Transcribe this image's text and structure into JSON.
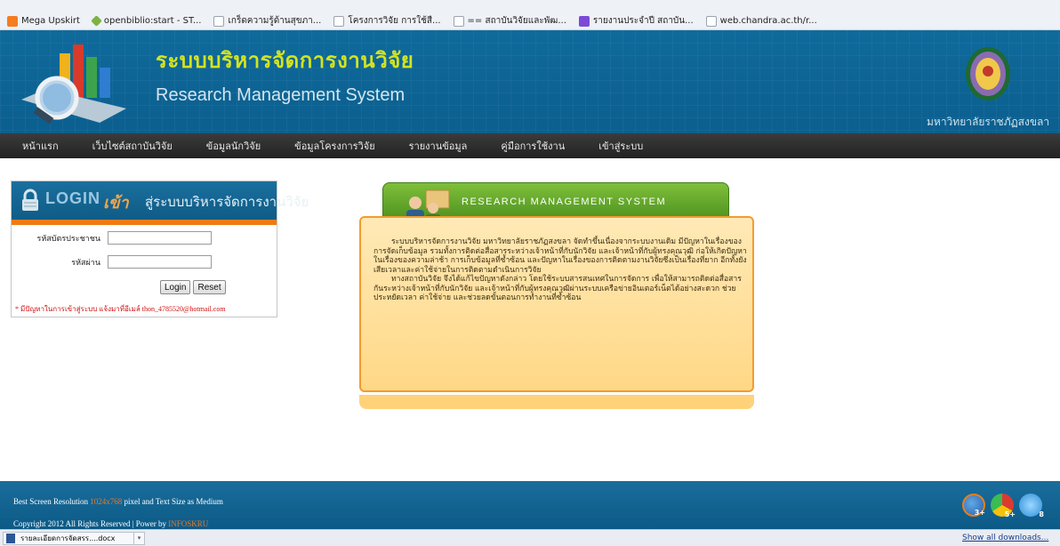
{
  "bookmarks": [
    {
      "label": "Mega Upskirt",
      "icon": "blogger-icon"
    },
    {
      "label": "openbiblio:start - ST...",
      "icon": "leaf-icon"
    },
    {
      "label": "เกร็ดความรู้ด้านสุขภา...",
      "icon": "page-icon"
    },
    {
      "label": "โครงการวิจัย การใช้สื...",
      "icon": "page-icon"
    },
    {
      "label": "== สถาบันวิจัยและพัฒ...",
      "icon": "page-icon"
    },
    {
      "label": "รายงานประจำปี สถาบัน...",
      "icon": "page-icon"
    },
    {
      "label": "web.chandra.ac.th/r...",
      "icon": "page-icon"
    }
  ],
  "header": {
    "title_th": "ระบบบริหารจัดการงานวิจัย",
    "title_en": "Research Management System",
    "university": "มหาวิทยาลัยราชภัฏสงขลา"
  },
  "nav": [
    "หน้าแรก",
    "เว็บไซต์สถาบันวิจัย",
    "ข้อมูลนักวิจัย",
    "ข้อมูลโครงการวิจัย",
    "รายงานข้อมูล",
    "คู่มือการใช้งาน",
    "เข้าสู่ระบบ"
  ],
  "login": {
    "heading_login": "LOGIN",
    "heading_enter": "เข้า",
    "heading_rest": "สู่ระบบบริหารจัดการงานวิจัย",
    "id_label": "รหัสบัตรประชาชน",
    "password_label": "รหัสผ่าน",
    "id_value": "",
    "password_value": "",
    "login_button": "Login",
    "reset_button": "Reset",
    "note": "* มีปัญหาในการเข้าสู่ระบบ แจ้งมาที่อีเมล์ thon_4785520@hotmail.com"
  },
  "info": {
    "tab_label": "RESEARCH MANAGEMENT SYSTEM",
    "paragraph1": "ระบบบริหารจัดการงานวิจัย มหาวิทยาลัยราชภัฏสงขลา จัดทำขึ้นเนื่องจากระบบงานเดิม มีปัญหาในเรื่องของการจัดเก็บข้อมูล รวมทั้งการติดต่อสื่อสารระหว่างเจ้าหน้าที่กับนักวิจัย และเจ้าหน้าที่กับผู้ทรงคุณวุฒิ ก่อให้เกิดปัญหาในเรื่องของความล่าช้า การเก็บข้อมูลที่ซ้ำซ้อน และปัญหาในเรื่องของการติดตามงานวิจัยซึ่งเป็นเรื่องที่ยาก อีกทั้งยังเสียเวลาและค่าใช้จ่ายในการติดตามดำเนินการวิจัย",
    "paragraph2": "ทางสถาบันวิจัย จึงได้แก้ไขปัญหาดังกล่าว โดยใช้ระบบสารสนเทศในการจัดการ เพื่อให้สามารถติดต่อสื่อสารกันระหว่างเจ้าหน้าที่กับนักวิจัย และเจ้าหน้าที่กับผู้ทรงคุณวุฒิผ่านระบบเครือข่ายอินเตอร์เน็ตได้อย่างสะดวก ช่วยประหยัดเวลา ค่าใช้จ่าย และช่วยลดขั้นตอนการทำงานที่ซ้ำซ้อน"
  },
  "footer": {
    "line1_pre": "Best Screen Resolution",
    "resolution": "1024x768",
    "line1_post": "pixel and Text Size as Medium",
    "line2_pre": "Copyright 2012 All Rights Reserved | Power by",
    "power_by": "INFOSKRU",
    "browser_badges": [
      "3+",
      "5+",
      "8"
    ]
  },
  "downloads": {
    "item": "รายละเอียดการจัดสรร....docx",
    "show_all": "Show all downloads..."
  }
}
